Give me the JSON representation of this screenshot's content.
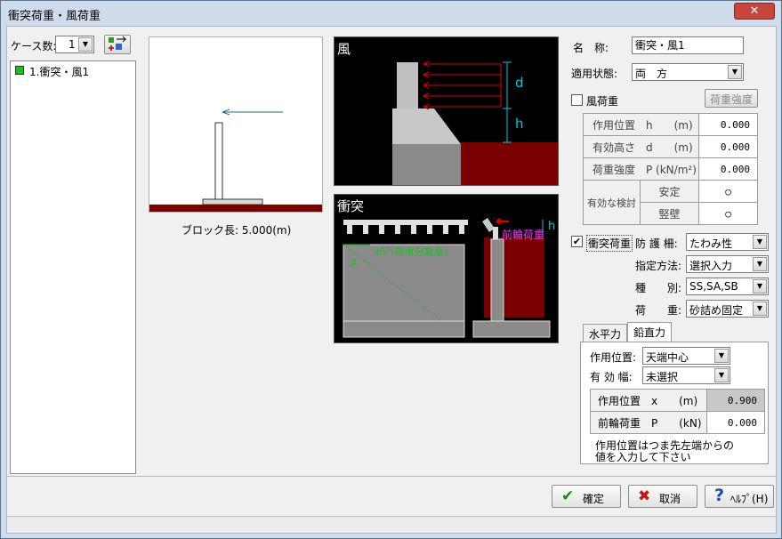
{
  "window": {
    "title": "衝突荷重・風荷重",
    "close_glyph": "✕"
  },
  "left": {
    "case_count_label": "ケース数:",
    "case_count_value": "1",
    "cases": [
      {
        "label": "1.衝突・風1",
        "color": "#11c711"
      }
    ]
  },
  "preview": {
    "block_length_text": "ブロック長: 5.000(m)"
  },
  "wind_diagram": {
    "title": "風",
    "label_d": "d",
    "label_h": "h"
  },
  "collision_diagram": {
    "title": "衝突",
    "angle_label": "45°(荷重分散角)",
    "label_a": "A",
    "label_front": "前輪荷重",
    "label_h": "h"
  },
  "form": {
    "name_label": "名　称:",
    "name_value": "衝突・風1",
    "apply_state_label": "適用状態:",
    "apply_state_value": "両　方",
    "wind": {
      "checkbox_label": "風荷重",
      "checked": false,
      "strength_button": "荷重強度",
      "rows": [
        {
          "label": "作用位置　h　　(m)",
          "value": "0.000"
        },
        {
          "label": "有効高さ　d　　(m)",
          "value": "0.000"
        },
        {
          "label": "荷重強度　P (kN/m²)",
          "value": "0.000"
        }
      ],
      "check_label": "有効な検討",
      "check_rows": [
        {
          "label": "安定",
          "mark": "○"
        },
        {
          "label": "竪壁",
          "mark": "○"
        }
      ]
    },
    "collision": {
      "checkbox_label": "衝突荷重",
      "checked": true,
      "guard_label": "防 護 柵:",
      "guard_value": "たわみ性",
      "method_label": "指定方法:",
      "method_value": "選択入力",
      "type_label": "種　　別:",
      "type_value": "SS,SA,SB",
      "load_label": "荷　　重:",
      "load_value": "砂詰め固定"
    },
    "tabs": [
      {
        "label": "水平力",
        "active": false
      },
      {
        "label": "鉛直力",
        "active": true
      }
    ],
    "vertical": {
      "position_label": "作用位置:",
      "position_value": "天端中心",
      "width_label": "有 効 幅:",
      "width_value": "未選択",
      "rows": [
        {
          "label": "作用位置　x　　(m)",
          "value": "0.900",
          "gray": true
        },
        {
          "label": "前輪荷重　P　　(kN)",
          "value": "0.000",
          "gray": false
        }
      ],
      "note_line1": "作用位置はつま先左端からの",
      "note_line2": "値を入力して下さい"
    }
  },
  "buttons": {
    "ok": {
      "label": "確定",
      "icon": "✔"
    },
    "cancel": {
      "label": "取消",
      "icon": "✖"
    },
    "help": {
      "label": "ﾍﾙﾌﾟ(H)",
      "icon": "?"
    }
  },
  "colors": {
    "dark_red": "#7a0000",
    "diagram_bg": "#000000",
    "wall_gray": "#8c8c8c",
    "cyan": "#00c8e0"
  }
}
